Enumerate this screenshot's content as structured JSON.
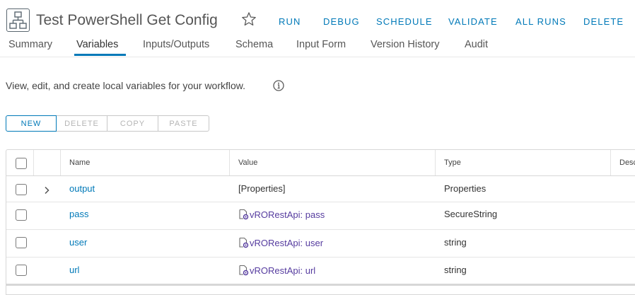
{
  "header": {
    "title": "Test PowerShell Get Config",
    "workflow_icon": "workflow-icon",
    "star_icon": "star-outline-icon",
    "actions": [
      "RUN",
      "DEBUG",
      "SCHEDULE",
      "VALIDATE",
      "ALL RUNS",
      "DELETE"
    ]
  },
  "tabs": {
    "items": [
      "Summary",
      "Variables",
      "Inputs/Outputs",
      "Schema",
      "Input Form",
      "Version History",
      "Audit"
    ],
    "active": "Variables"
  },
  "description": {
    "text": "View, edit, and create local variables for your workflow.",
    "info_icon": "info-icon"
  },
  "toolbar": {
    "new_label": "NEW",
    "delete_label": "DELETE",
    "copy_label": "COPY",
    "paste_label": "PASTE"
  },
  "grid": {
    "columns": [
      "Name",
      "Value",
      "Type",
      "Desc"
    ],
    "rows": [
      {
        "name": "output",
        "value": "[Properties]",
        "type": "Properties",
        "expandable": true,
        "value_icon": ""
      },
      {
        "name": "pass",
        "value": "vRORestApi: pass",
        "type": "SecureString",
        "expandable": false,
        "value_icon": "configuration-element-icon"
      },
      {
        "name": "user",
        "value": "vRORestApi: user",
        "type": "string",
        "expandable": false,
        "value_icon": "configuration-element-icon"
      },
      {
        "name": "url",
        "value": "vRORestApi: url",
        "type": "string",
        "expandable": false,
        "value_icon": "configuration-element-icon"
      }
    ]
  },
  "colors": {
    "accent": "#0079b8",
    "value_link": "#563c9f",
    "border": "#d7d7d7"
  }
}
